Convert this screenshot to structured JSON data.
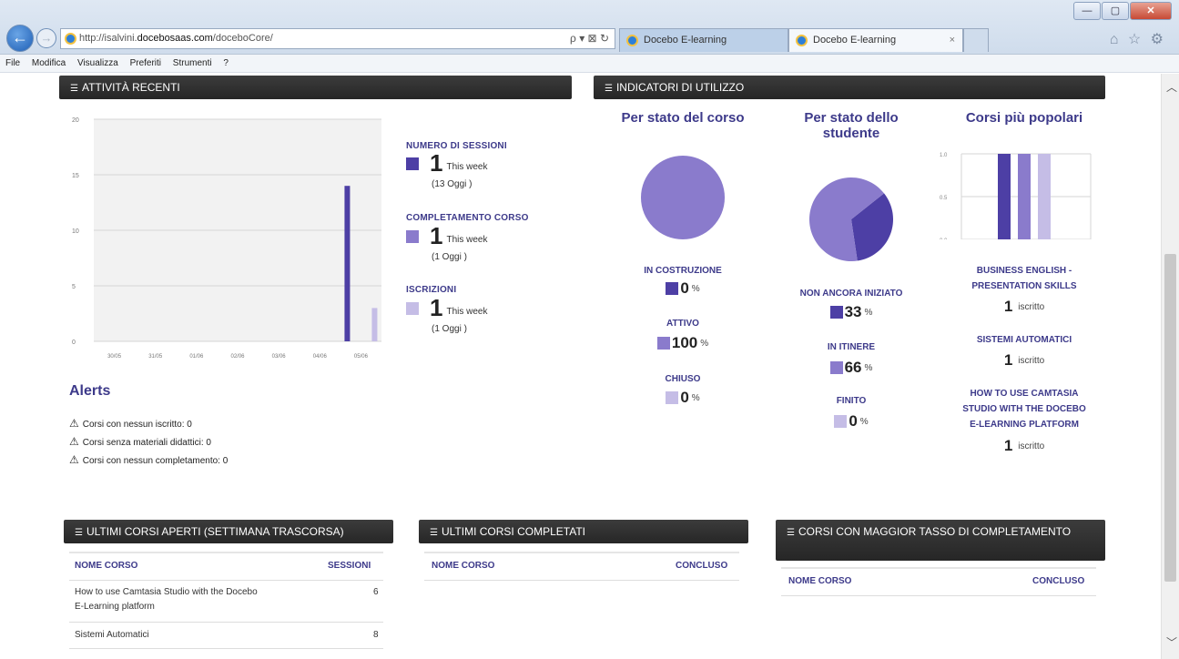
{
  "browser": {
    "url_prefix": "http://isalvini.",
    "url_domain": "docebosaas.com",
    "url_path": "/doceboCore/",
    "address_tools": "ρ ▾ ⊠ ↻",
    "tabs": [
      {
        "label": "Docebo E-learning"
      },
      {
        "label": "Docebo E-learning"
      }
    ],
    "tab_close": "×",
    "toolbar_icons": "⌂ ☆ ⚙",
    "window_controls": {
      "minimize": "—",
      "maximize": "▢",
      "close": "✕"
    },
    "back_glyph": "←",
    "forward_glyph": "→"
  },
  "menu": [
    "File",
    "Modifica",
    "Visualizza",
    "Preferiti",
    "Strumenti",
    "?"
  ],
  "sections": {
    "recent": "ATTIVITÀ RECENTI",
    "usage": "INDICATORI DI UTILIZZO",
    "open_courses": "ULTIMI CORSI APERTI (SETTIMANA TRASCORSA)",
    "completed_courses": "ULTIMI CORSI COMPLETATI",
    "completion_rate": "CORSI CON MAGGIOR TASSO DI COMPLETAMENTO"
  },
  "chart_data": [
    {
      "type": "bar",
      "title": "",
      "categories": [
        "30/05",
        "31/05",
        "01/06",
        "02/06",
        "03/06",
        "04/06",
        "05/06"
      ],
      "y_ticks": [
        "20",
        "15",
        "10",
        "5",
        "0"
      ],
      "ylim": [
        0,
        20
      ],
      "grid": true,
      "series": [
        {
          "name": "NUMERO DI SESSIONI",
          "color": "#4d3fa5",
          "values": [
            0,
            0,
            0,
            0,
            0,
            0,
            14
          ]
        },
        {
          "name": "COMPLETAMENTO CORSO",
          "color": "#8a7bcc",
          "values": [
            0,
            0,
            0,
            0,
            0,
            0,
            0
          ]
        },
        {
          "name": "ISCRIZIONI",
          "color": "#c5bde6",
          "values": [
            0,
            0,
            0,
            0,
            0,
            0,
            3
          ]
        }
      ]
    },
    {
      "type": "pie",
      "title": "Per stato del corso",
      "slices": [
        {
          "label": "IN COSTRUZIONE",
          "value": 0,
          "color": "#4d3fa5"
        },
        {
          "label": "ATTIVO",
          "value": 100,
          "color": "#8a7bcc"
        },
        {
          "label": "CHIUSO",
          "value": 0,
          "color": "#c5bde6"
        }
      ]
    },
    {
      "type": "pie",
      "title": "Per stato dello studente",
      "slices": [
        {
          "label": "NON ANCORA INIZIATO",
          "value": 33,
          "color": "#4d3fa5"
        },
        {
          "label": "IN ITINERE",
          "value": 66,
          "color": "#8a7bcc"
        },
        {
          "label": "FINITO",
          "value": 0,
          "color": "#c5bde6"
        }
      ]
    },
    {
      "type": "bar",
      "title": "Corsi più popolari",
      "y_ticks": [
        "1.0",
        "0.5",
        "0.0"
      ],
      "ylim": [
        0,
        1
      ],
      "grid": true,
      "categories": [
        "BUSINESS ENGLISH - PRESENTATION SKILLS",
        "SISTEMI AUTOMATICI",
        "HOW TO USE CAMTASIA STUDIO WITH THE DOCEBO E-LEARNING PLATFORM"
      ],
      "values": [
        1,
        1,
        1
      ],
      "colors": [
        "#4d3fa5",
        "#8a7bcc",
        "#c5bde6"
      ]
    }
  ],
  "legend": [
    {
      "title": "NUMERO DI SESSIONI",
      "color": "#4d3fa5",
      "value": "1",
      "unit": "This week",
      "sub": "(13 Oggi )"
    },
    {
      "title": "COMPLETAMENTO CORSO",
      "color": "#8a7bcc",
      "value": "1",
      "unit": "This week",
      "sub": "(1 Oggi )"
    },
    {
      "title": "ISCRIZIONI",
      "color": "#c5bde6",
      "value": "1",
      "unit": "This week",
      "sub": "(1 Oggi )"
    }
  ],
  "alerts": {
    "title": "Alerts",
    "items": [
      "Corsi con nessun iscritto: 0",
      "Corsi senza materiali didattici: 0",
      "Corsi con nessun completamento: 0"
    ]
  },
  "usage": {
    "course_status": {
      "title": "Per stato del corso",
      "items": [
        {
          "label": "IN COSTRUZIONE",
          "value": "0",
          "unit": "%",
          "color": "#4d3fa5"
        },
        {
          "label": "ATTIVO",
          "value": "100",
          "unit": "%",
          "color": "#8a7bcc"
        },
        {
          "label": "CHIUSO",
          "value": "0",
          "unit": "%",
          "color": "#c5bde6"
        }
      ]
    },
    "student_status": {
      "title_line1": "Per stato dello",
      "title_line2": "studente",
      "items": [
        {
          "label": "NON ANCORA INIZIATO",
          "value": "33",
          "unit": "%",
          "color": "#4d3fa5"
        },
        {
          "label": "IN ITINERE",
          "value": "66",
          "unit": "%",
          "color": "#8a7bcc"
        },
        {
          "label": "FINITO",
          "value": "0",
          "unit": "%",
          "color": "#c5bde6"
        }
      ]
    },
    "popular": {
      "title": "Corsi più popolari",
      "courses": [
        {
          "name_line1": "BUSINESS ENGLISH -",
          "name_line2": "PRESENTATION SKILLS",
          "count": "1",
          "unit": "iscritto"
        },
        {
          "name_line1": "SISTEMI AUTOMATICI",
          "count": "1",
          "unit": "iscritto"
        },
        {
          "name_line1": "HOW TO USE CAMTASIA",
          "name_line2": "STUDIO WITH THE DOCEBO",
          "name_line3": "E-LEARNING PLATFORM",
          "count": "1",
          "unit": "iscritto"
        }
      ]
    }
  },
  "tables": {
    "open": {
      "col_name": "NOME CORSO",
      "col_sessions": "SESSIONI",
      "rows": [
        {
          "name_line1": "How to use Camtasia Studio with the Docebo",
          "name_line2": "E-Learning platform",
          "sessions": "6"
        },
        {
          "name_line1": "Sistemi Automatici",
          "sessions": "8"
        }
      ]
    },
    "completed": {
      "col_name": "NOME CORSO",
      "col_done": "CONCLUSO"
    },
    "rate": {
      "col_name": "NOME CORSO",
      "col_done": "CONCLUSO"
    }
  }
}
